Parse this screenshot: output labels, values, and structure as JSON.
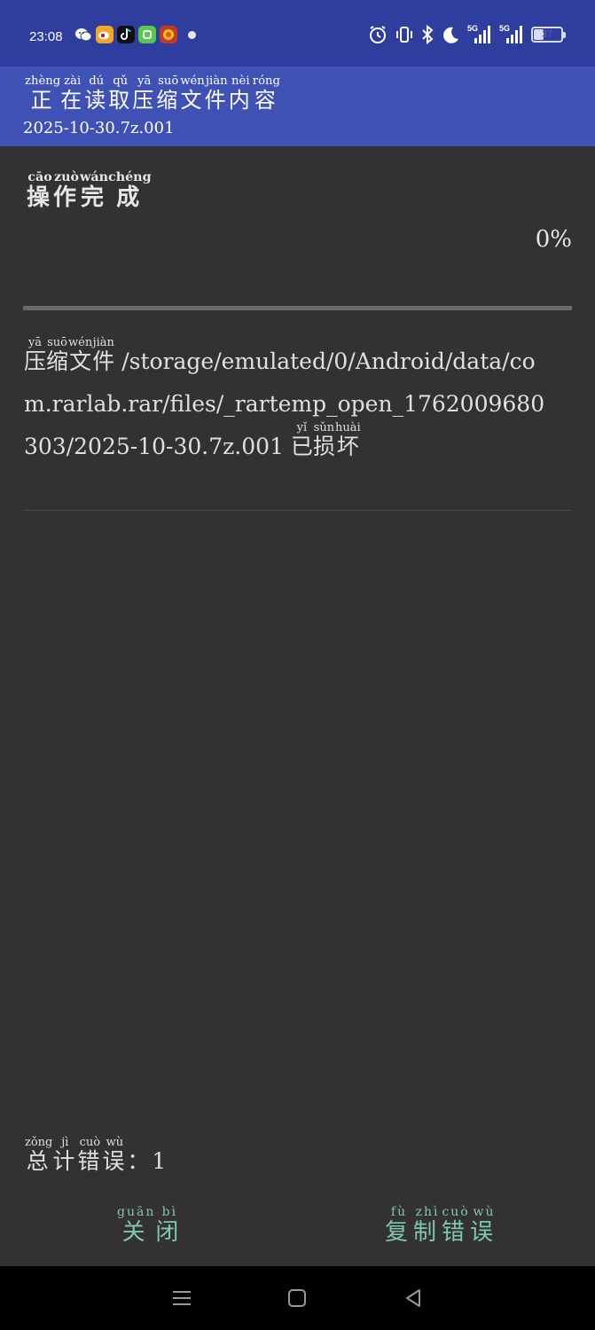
{
  "status_bar": {
    "time": "23:08",
    "battery_level": "37",
    "network_labels": [
      "5G",
      "5G"
    ],
    "notification_icons": [
      "wechat-icon",
      "weibo-icon",
      "tiktok-icon",
      "green-app-icon",
      "game-app-icon",
      "dot-icon"
    ],
    "system_icons": [
      "alarm-icon",
      "vibrate-icon",
      "bluetooth-icon",
      "moon-icon",
      "signal-5g-icon",
      "signal-5g-icon",
      "battery-icon"
    ]
  },
  "header": {
    "title": [
      "正",
      "在",
      "读",
      "取",
      "压",
      "缩",
      "文",
      "件",
      "内",
      "容"
    ],
    "title_pinyin": [
      "zhèng",
      "zài",
      "dú",
      "qǔ",
      "yā",
      "suō",
      "wén",
      "jiàn",
      "nèi",
      "róng"
    ],
    "filename": "2025-10-30.7z.001"
  },
  "operation": {
    "status": [
      "操",
      "作",
      "完",
      "成"
    ],
    "status_pinyin": [
      "cāo",
      "zuò",
      "wán",
      "chéng"
    ],
    "percent": "0%",
    "progress": 0
  },
  "message": {
    "prefix": [
      "压",
      "缩",
      "文",
      "件"
    ],
    "prefix_pinyin": [
      "yā",
      "suō",
      "wén",
      "jiàn"
    ],
    "path": " /storage/emulated/0/Android/data/com.rarlab.rar/files/_rartemp_open_1762009680303/2025-10-30.7z.001 ",
    "suffix": [
      "已",
      "损",
      "坏"
    ],
    "suffix_pinyin": [
      "yǐ",
      "sǔn",
      "huài"
    ]
  },
  "summary": {
    "label": [
      "总",
      "计",
      "错",
      "误"
    ],
    "label_pinyin": [
      "zǒng",
      "jì",
      "cuò",
      "wù"
    ],
    "separator": "：",
    "count": "1"
  },
  "buttons": {
    "close": [
      "关",
      "闭"
    ],
    "close_pinyin": [
      "guān",
      "bì"
    ],
    "copy_errors": [
      "复",
      "制",
      "错",
      "误"
    ],
    "copy_errors_pinyin": [
      "fù",
      "zhì",
      "cuò",
      "wù"
    ]
  },
  "colors": {
    "status_bar": "#2f3e9e",
    "header": "#3f51b5",
    "background": "#333134",
    "button_text": "#7ec9a7"
  },
  "nav_bar": {
    "icons": [
      "menu-icon",
      "home-icon",
      "back-icon"
    ]
  }
}
